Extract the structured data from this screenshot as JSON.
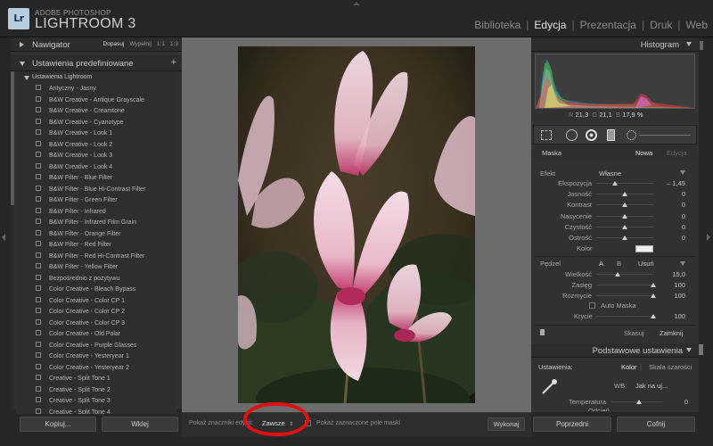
{
  "app": {
    "logo": "Lr",
    "brand_top": "ADOBE PHOTOSHOP",
    "brand_main": "LIGHTROOM 3",
    "modules": [
      "Biblioteka",
      "Edycja",
      "Prezentacja",
      "Druk",
      "Web"
    ],
    "active_module": "Edycja"
  },
  "navigator": {
    "title": "Nawigator",
    "zoom": [
      "Dopasuj",
      "Wypełnij",
      "1:1",
      "1:3"
    ]
  },
  "presets": {
    "title": "Ustawienia predefiniowane",
    "plus": "+",
    "folder": "Ustawienia Lightroom",
    "items": [
      "Antyczny - Jasny",
      "B&W Creative - Antique Grayscale",
      "B&W Creative - Creamtone",
      "B&W Creative - Cyanotype",
      "B&W Creative - Look 1",
      "B&W Creative - Look 2",
      "B&W Creative - Look 3",
      "B&W Creative - Look 4",
      "B&W Filter - Blue Filter",
      "B&W Filter - Blue Hi-Contrast Filter",
      "B&W Filter - Green Filter",
      "B&W Filter - Infrared",
      "B&W Filter - Infrared Film Grain",
      "B&W Filter - Orange Filter",
      "B&W Filter - Red Filter",
      "B&W Filter - Red Hi-Contrast Filter",
      "B&W Filter - Yellow Filter",
      "Bezpośrednio z pozytywu",
      "Color Creative - Bleach Bypass",
      "Color Creative - Color CP 1",
      "Color Creative - Color CP 2",
      "Color Creative - Color CP 3",
      "Color Creative - Old Polar",
      "Color Creative - Purple Glasses",
      "Color Creative - Yesteryear 1",
      "Color Creative - Yesteryear 2",
      "Creative - Split Tone 1",
      "Creative - Split Tone 2",
      "Creative - Split Tone 3",
      "Creative - Split Tone 4"
    ]
  },
  "left_buttons": {
    "copy": "Kopiuj...",
    "paste": "Wklej"
  },
  "toolbar": {
    "show_label": "Pokaż znaczniki edycji:",
    "show_value": "Zawsze",
    "mask_label": "Pokaż zaznaczone pole maski",
    "done": "Wykonaj"
  },
  "histogram": {
    "title": "Histogram",
    "r_label": "R",
    "r": "21,3",
    "g_label": "G",
    "g": "21,1",
    "b_label": "B",
    "b": "17,9",
    "unit": "%"
  },
  "mask": {
    "label": "Maska",
    "new": "Nowa",
    "edit": "Edycja",
    "effect_label": "Efekt",
    "effect_value": "Własne",
    "sliders": [
      {
        "label": "Ekspozycja",
        "value": "– 1,45",
        "pos": 0.33
      },
      {
        "label": "Jasność",
        "value": "0",
        "pos": 0.5
      },
      {
        "label": "Kontrast",
        "value": "0",
        "pos": 0.5
      },
      {
        "label": "Nasycenie",
        "value": "0",
        "pos": 0.5
      },
      {
        "label": "Czystość",
        "value": "0",
        "pos": 0.5
      },
      {
        "label": "Ostrość",
        "value": "0",
        "pos": 0.5
      }
    ],
    "color_label": "Kolor"
  },
  "brush": {
    "label": "Pędzel",
    "a": "A",
    "b": "B",
    "erase": "Usuń",
    "sliders": [
      {
        "label": "Wielkość",
        "value": "15,0",
        "pos": 0.38
      },
      {
        "label": "Zasięg",
        "value": "100",
        "pos": 1.0
      },
      {
        "label": "Rozmycie",
        "value": "100",
        "pos": 1.0
      }
    ],
    "auto_mask": "Auto Maska",
    "density_label": "Krycie",
    "density_value": "100",
    "density_pos": 1.0
  },
  "mask_actions": {
    "reset": "Skasuj",
    "close": "Zamknij"
  },
  "basic": {
    "title": "Podstawowe ustawienia",
    "settings_label": "Ustawienia:",
    "color": "Kolor",
    "grayscale": "Skala szarości",
    "wb_label": "WB:",
    "wb_value": "Jak na uj...",
    "temp_label": "Temperatura",
    "temp_value": "0",
    "tint_label": "Odcień"
  },
  "right_buttons": {
    "previous": "Poprzedni",
    "reset": "Cofnij"
  },
  "colors": {
    "highlight": "#e01010",
    "panel": "#313131",
    "center": "#6c6c6c"
  }
}
